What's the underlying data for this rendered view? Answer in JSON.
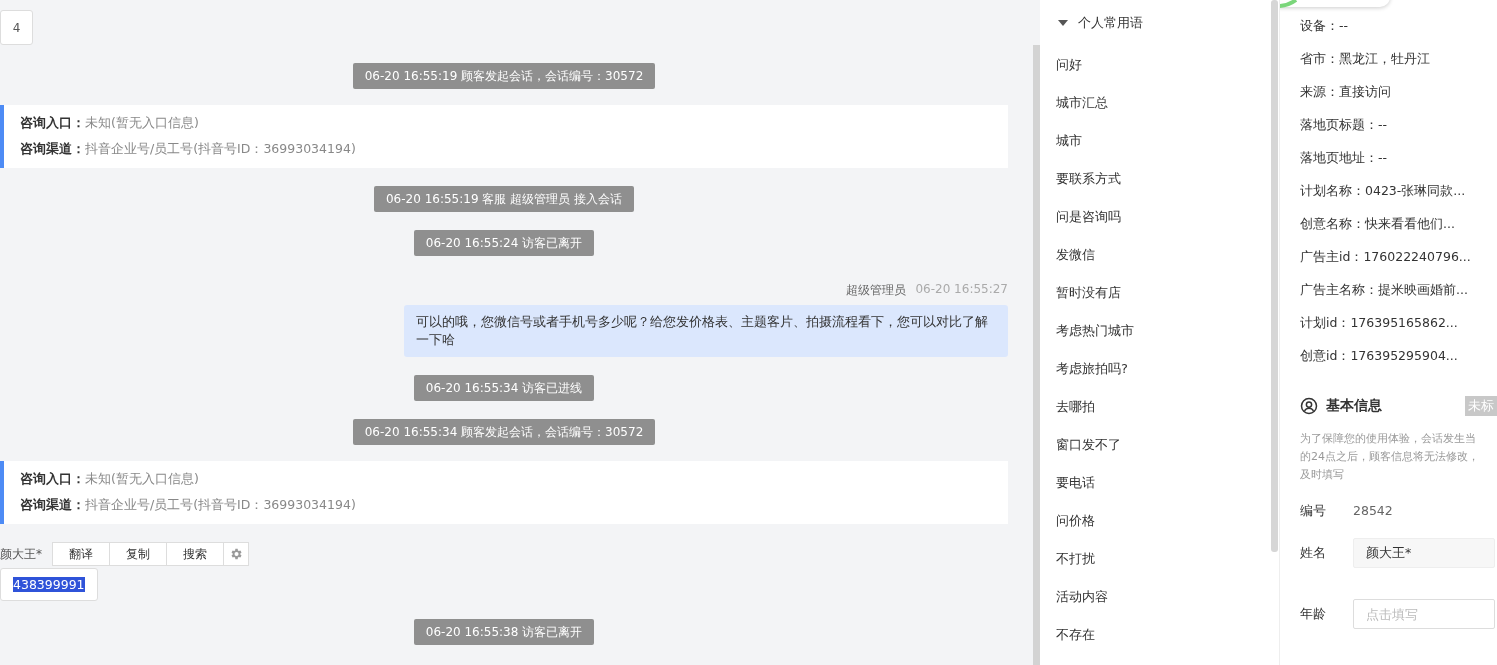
{
  "chat": {
    "page_number": "4",
    "messages": [
      {
        "kind": "system",
        "text": "06-20 16:55:19 顾客发起会话，会话编号：30572"
      },
      {
        "kind": "info",
        "entry_label": "咨询入口：",
        "entry_value": "未知(暂无入口信息)",
        "channel_label": "咨询渠道：",
        "channel_value": "抖音企业号/员工号(抖音号ID：36993034194)"
      },
      {
        "kind": "system",
        "text": "06-20 16:55:19 客服 超级管理员 接入会话"
      },
      {
        "kind": "system",
        "text": "06-20 16:55:24 访客已离开"
      },
      {
        "kind": "agent",
        "sender": "超级管理员",
        "time": "06-20 16:55:27",
        "text": "可以的哦，您微信号或者手机号多少呢？给您发价格表、主题客片、拍摄流程看下，您可以对比了解一下哈"
      },
      {
        "kind": "system",
        "text": "06-20 16:55:34 访客已进线"
      },
      {
        "kind": "system",
        "text": "06-20 16:55:34 顾客发起会话，会话编号：30572"
      },
      {
        "kind": "info",
        "entry_label": "咨询入口：",
        "entry_value": "未知(暂无入口信息)",
        "channel_label": "咨询渠道：",
        "channel_value": "抖音企业号/员工号(抖音号ID：36993034194)"
      },
      {
        "kind": "visitor",
        "sender": "颜大王*",
        "text": "438399991",
        "selected_text": true,
        "context_menu": [
          "翻译",
          "复制",
          "搜索"
        ]
      },
      {
        "kind": "system",
        "text": "06-20 16:55:38 访客已离开"
      }
    ]
  },
  "phrases": {
    "group": "个人常用语",
    "expanded": true,
    "items": [
      "问好",
      "城市汇总",
      "城市",
      "要联系方式",
      "问是咨询吗",
      "发微信",
      "暂时没有店",
      "考虑热门城市",
      "考虑旅拍吗?",
      "去哪拍",
      "窗口发不了",
      "要电话",
      "问价格",
      "不打扰",
      "活动内容",
      "不存在"
    ]
  },
  "visitor_info": {
    "fields": [
      "设备：--",
      "省市：黑龙江，牡丹江",
      "来源：直接访问",
      "落地页标题：--",
      "落地页地址：--",
      "计划名称：0423-张琳同款...",
      "创意名称：快来看看他们...",
      "广告主id：176022240796...",
      "广告主名称：提米映画婚前...",
      "计划id：176395165862...",
      "创意id：176395295904..."
    ]
  },
  "basic_info": {
    "title": "基本信息",
    "tag": "未标",
    "notice": [
      "为了保障您的使用体验，会话发生当",
      "的24点之后，顾客信息将无法修改，",
      "及时填写"
    ],
    "id_label": "编号",
    "id_value": "28542",
    "name_label": "姓名",
    "name_value": "颜大王*",
    "age_label": "年龄",
    "age_placeholder": "点击填写"
  }
}
